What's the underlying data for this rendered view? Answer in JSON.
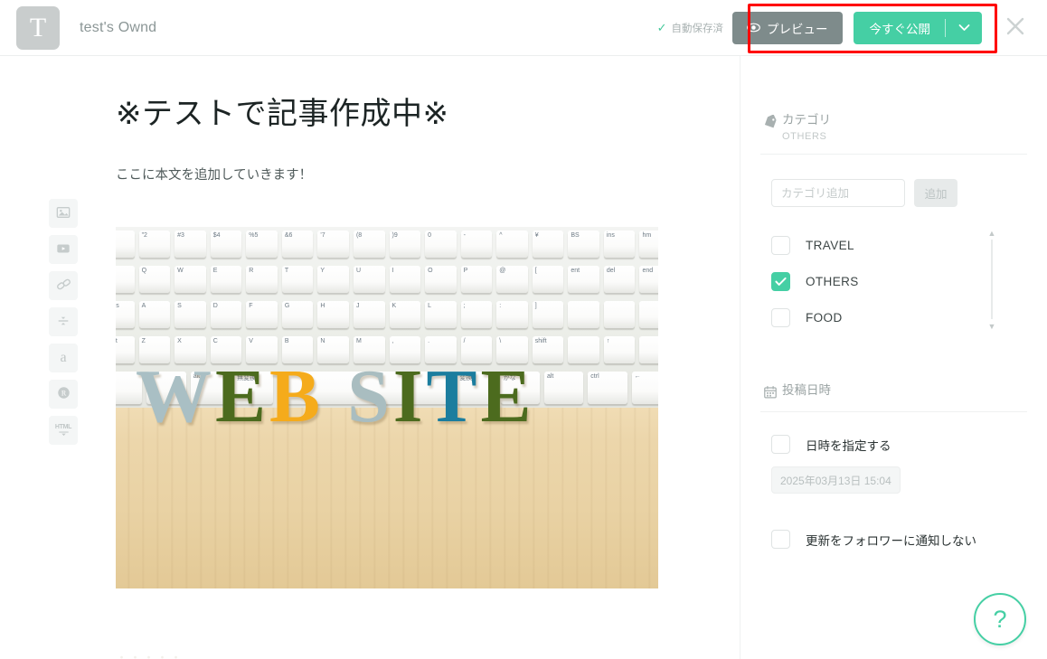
{
  "header": {
    "logo_letter": "T",
    "site_title": "test's Ownd",
    "autosave_text": "自動保存済",
    "autosave_check": "✓",
    "preview_label": "プレビュー",
    "publish_label": "今すぐ公開",
    "close_label": "×",
    "accent_green": "#45cfa4",
    "preview_gray": "#7e8b8b",
    "annotation_color": "#ff0000"
  },
  "insert_toolbar": {
    "items": [
      {
        "name": "image-icon",
        "label": "画像"
      },
      {
        "name": "video-icon",
        "label": "動画"
      },
      {
        "name": "link-icon",
        "label": "リンク"
      },
      {
        "name": "divider-icon",
        "label": "区切り線"
      },
      {
        "name": "amazon-icon",
        "label": "a"
      },
      {
        "name": "rakuten-icon",
        "label": "R"
      },
      {
        "name": "html-icon",
        "label": "HTML"
      }
    ]
  },
  "editor": {
    "title": "※テストで記事作成中※",
    "body": "ここに本文を追加していきます！",
    "image_alt": "WEB SITE wooden letters in front of a Japanese keyboard",
    "image_letters": [
      {
        "char": "W",
        "color": "#a9bfc4"
      },
      {
        "char": "E",
        "color": "#4c6b1e"
      },
      {
        "char": "B",
        "color": "#f5ab1b"
      },
      {
        "char": "S",
        "color": "#a9bdc0"
      },
      {
        "char": "I",
        "color": "#4c6b1e"
      },
      {
        "char": "T",
        "color": "#1b7d9e"
      },
      {
        "char": "E",
        "color": "#4c6b1e"
      }
    ],
    "trailing_text": "・・・・・"
  },
  "sidebar": {
    "category": {
      "icon": "tag-icon",
      "title": "カテゴリ",
      "subtitle": "OTHERS",
      "add_placeholder": "カテゴリ追加",
      "add_input_value": "",
      "add_button_label": "追加",
      "items": [
        {
          "label": "TRAVEL",
          "checked": false
        },
        {
          "label": "OTHERS",
          "checked": true
        },
        {
          "label": "FOOD",
          "checked": false
        }
      ],
      "scroll_up": "▲",
      "scroll_down": "▼"
    },
    "schedule": {
      "icon": "calendar-icon",
      "title": "投稿日時",
      "specify_label": "日時を指定する",
      "specify_checked": false,
      "datetime_value": "2025年03月13日 15:04"
    },
    "notify": {
      "label": "更新をフォロワーに通知しない",
      "checked": false
    }
  },
  "help": {
    "label": "?"
  }
}
